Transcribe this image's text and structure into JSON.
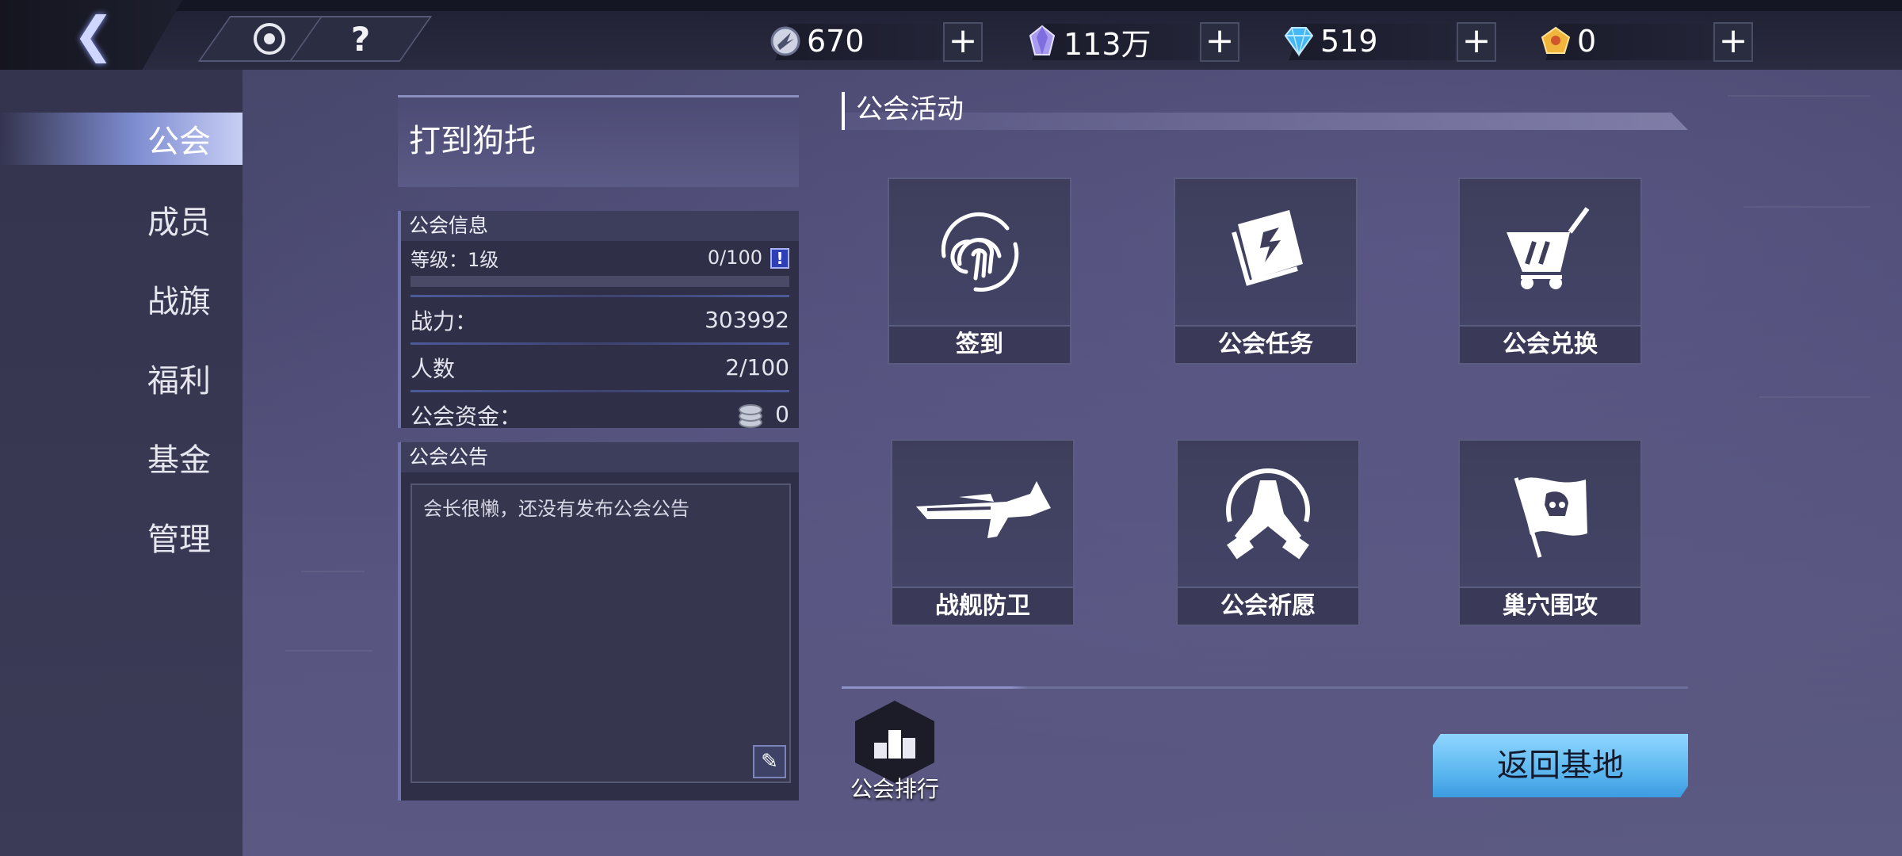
{
  "topbar": {
    "back_icon": "back-arrow-icon",
    "tabs": [
      {
        "name": "target-icon",
        "glyph": ""
      },
      {
        "name": "help-icon",
        "glyph": "?"
      }
    ],
    "resources": [
      {
        "icon": "energy-orb-icon",
        "value": "670",
        "plus": "+"
      },
      {
        "icon": "purple-crystal-icon",
        "value": "113万",
        "plus": "+"
      },
      {
        "icon": "blue-diamond-icon",
        "value": "519",
        "plus": "+"
      },
      {
        "icon": "gold-gem-icon",
        "value": "0",
        "plus": "+"
      }
    ]
  },
  "sidebar": {
    "items": [
      {
        "label": "公会",
        "active": true
      },
      {
        "label": "成员"
      },
      {
        "label": "战旗"
      },
      {
        "label": "福利"
      },
      {
        "label": "基金"
      },
      {
        "label": "管理"
      }
    ]
  },
  "guild": {
    "name": "打到狗托",
    "info_title": "公会信息",
    "level_label": "等级：1级",
    "level_progress": "0/100",
    "level_progress_fraction": 0,
    "power_label": "战力：",
    "power_value": "303992",
    "members_label": "人数",
    "members_value": "2/100",
    "funds_label": "公会资金：",
    "funds_value": "0",
    "notice_title": "公会公告",
    "notice_text": "会长很懒，还没有发布公会公告"
  },
  "activities": {
    "title": "公会活动",
    "tiles": [
      {
        "label": "签到",
        "icon": "fingerprint-icon"
      },
      {
        "label": "公会任务",
        "icon": "task-book-icon"
      },
      {
        "label": "公会兑换",
        "icon": "shopping-cart-icon"
      },
      {
        "label": "战舰防卫",
        "icon": "warship-icon"
      },
      {
        "label": "公会祈愿",
        "icon": "praying-hands-icon"
      },
      {
        "label": "巢穴围攻",
        "icon": "skull-flag-icon"
      }
    ],
    "rank_label": "公会排行",
    "return_label": "返回基地"
  },
  "colors": {
    "accent_blue": "#5cb7f0",
    "sidebar_active": "#c8cff5",
    "panel_border": "#6f74b0"
  }
}
